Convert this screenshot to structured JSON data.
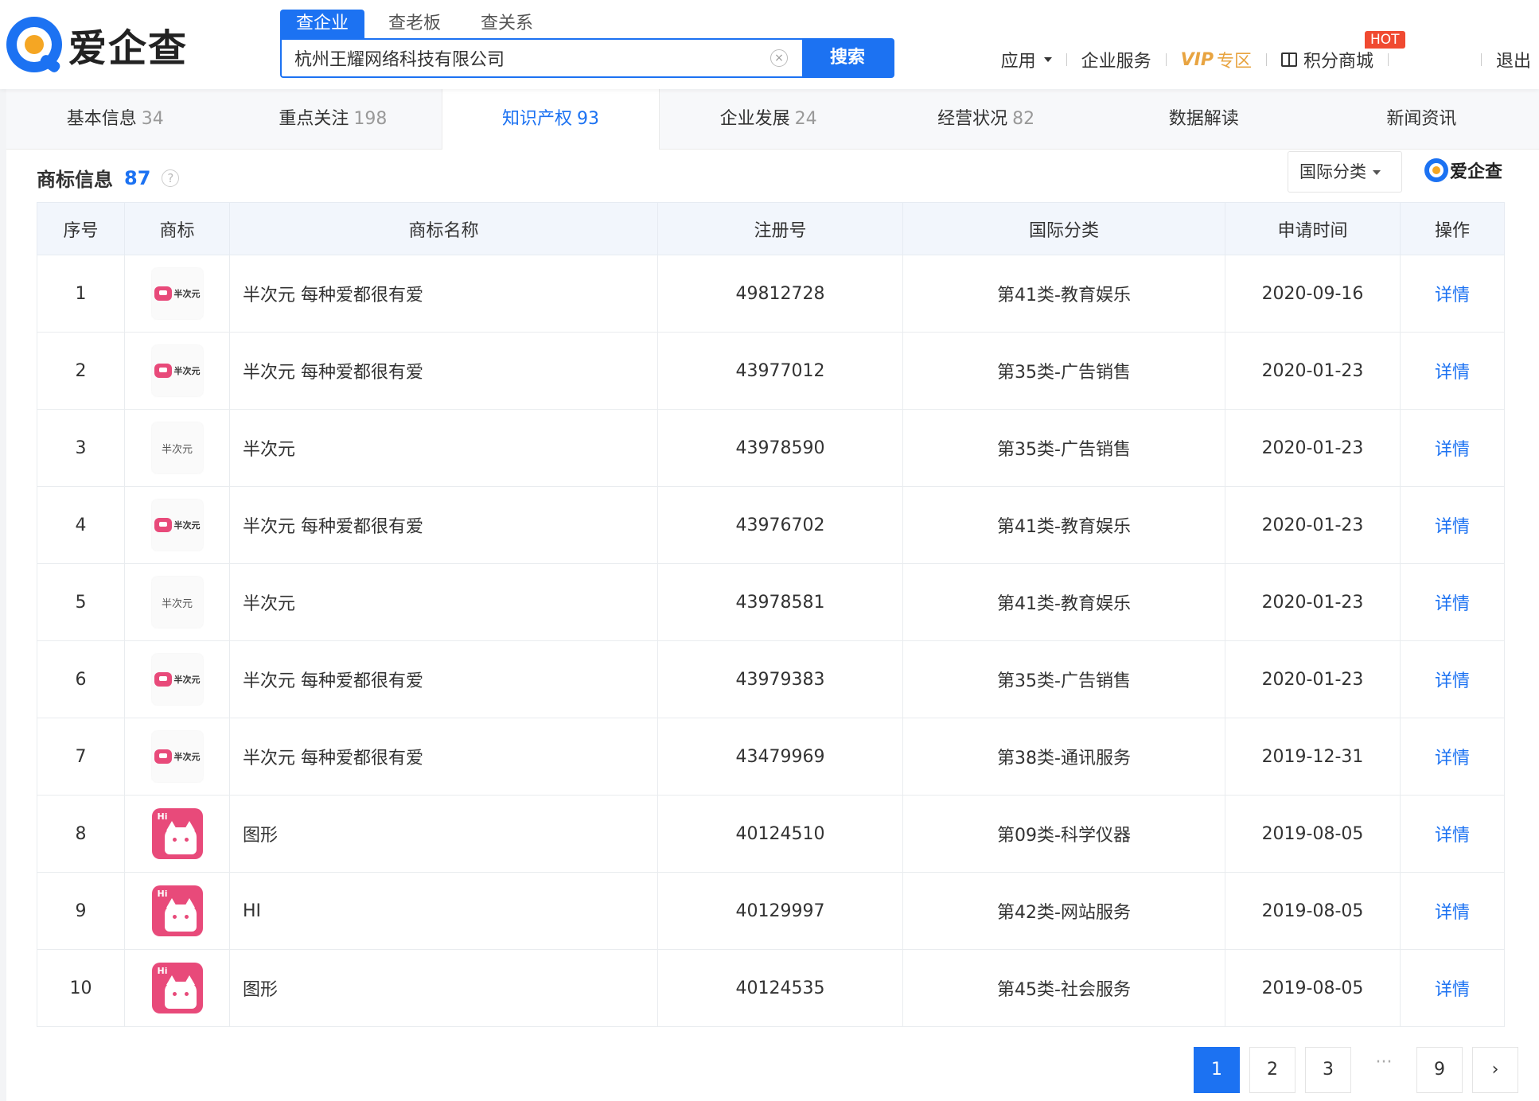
{
  "brand": {
    "name": "爱企查"
  },
  "search": {
    "tabs": [
      "查企业",
      "查老板",
      "查关系"
    ],
    "query": "杭州王耀网络科技有限公司",
    "clear_symbol": "×",
    "button": "搜索"
  },
  "topnav": {
    "apps": "应用",
    "enterprise": "企业服务",
    "vip": "VIP",
    "vip_sub": "专区",
    "points": "积分商城",
    "hot": "HOT",
    "logout": "退出"
  },
  "subtabs": [
    {
      "label": "基本信息",
      "count": "34"
    },
    {
      "label": "重点关注",
      "count": "198"
    },
    {
      "label": "知识产权",
      "count": "93"
    },
    {
      "label": "企业发展",
      "count": "24"
    },
    {
      "label": "经营状况",
      "count": "82"
    },
    {
      "label": "数据解读",
      "count": ""
    },
    {
      "label": "新闻资讯",
      "count": ""
    }
  ],
  "section": {
    "title": "商标信息",
    "count": "87",
    "help": "?",
    "filter": "国际分类",
    "watermark": "爱企查"
  },
  "table": {
    "headers": [
      "序号",
      "商标",
      "商标名称",
      "注册号",
      "国际分类",
      "申请时间",
      "操作"
    ],
    "rows": [
      {
        "idx": "1",
        "logo": "badge",
        "logo_text": "半次元",
        "name": "半次元 每种爱都很有爱",
        "reg": "49812728",
        "cls": "第41类-教育娱乐",
        "date": "2020-09-16",
        "op": "详情"
      },
      {
        "idx": "2",
        "logo": "badge",
        "logo_text": "半次元",
        "name": "半次元 每种爱都很有爱",
        "reg": "43977012",
        "cls": "第35类-广告销售",
        "date": "2020-01-23",
        "op": "详情"
      },
      {
        "idx": "3",
        "logo": "text",
        "logo_text": "半次元",
        "name": "半次元",
        "reg": "43978590",
        "cls": "第35类-广告销售",
        "date": "2020-01-23",
        "op": "详情"
      },
      {
        "idx": "4",
        "logo": "badge",
        "logo_text": "半次元",
        "name": "半次元 每种爱都很有爱",
        "reg": "43976702",
        "cls": "第41类-教育娱乐",
        "date": "2020-01-23",
        "op": "详情"
      },
      {
        "idx": "5",
        "logo": "text",
        "logo_text": "半次元",
        "name": "半次元",
        "reg": "43978581",
        "cls": "第41类-教育娱乐",
        "date": "2020-01-23",
        "op": "详情"
      },
      {
        "idx": "6",
        "logo": "badge",
        "logo_text": "半次元",
        "name": "半次元 每种爱都很有爱",
        "reg": "43979383",
        "cls": "第35类-广告销售",
        "date": "2020-01-23",
        "op": "详情"
      },
      {
        "idx": "7",
        "logo": "badge",
        "logo_text": "半次元",
        "name": "半次元 每种爱都很有爱",
        "reg": "43479969",
        "cls": "第38类-通讯服务",
        "date": "2019-12-31",
        "op": "详情"
      },
      {
        "idx": "8",
        "logo": "cat",
        "logo_text": "Hi",
        "name": "图形",
        "reg": "40124510",
        "cls": "第09类-科学仪器",
        "date": "2019-08-05",
        "op": "详情"
      },
      {
        "idx": "9",
        "logo": "cat",
        "logo_text": "Hi",
        "name": "HI",
        "reg": "40129997",
        "cls": "第42类-网站服务",
        "date": "2019-08-05",
        "op": "详情"
      },
      {
        "idx": "10",
        "logo": "cat",
        "logo_text": "Hi",
        "name": "图形",
        "reg": "40124535",
        "cls": "第45类-社会服务",
        "date": "2019-08-05",
        "op": "详情"
      }
    ]
  },
  "pagination": {
    "pages": [
      "1",
      "2",
      "3"
    ],
    "ellipsis": "···",
    "last": "9",
    "next": "›",
    "current": "1"
  }
}
